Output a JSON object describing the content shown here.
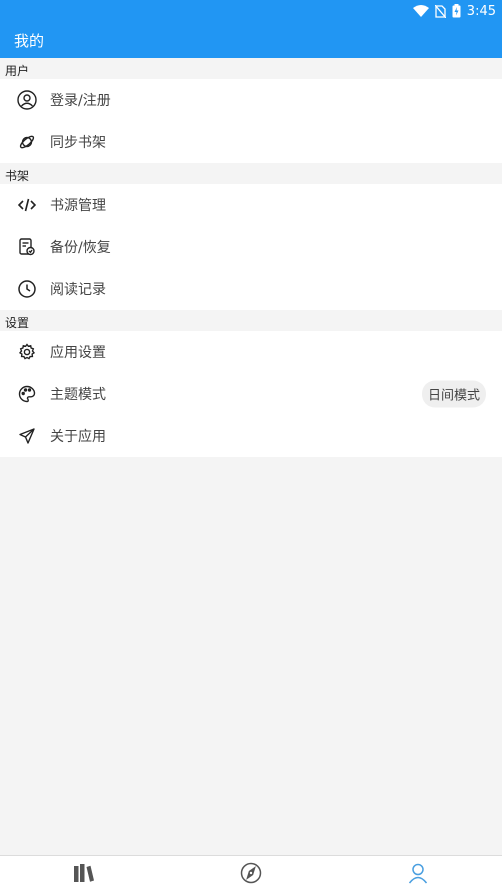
{
  "status": {
    "time": "3:45"
  },
  "app": {
    "title": "我的"
  },
  "sections": [
    {
      "label": "用户",
      "items": [
        {
          "label": "登录/注册",
          "icon": "user-icon"
        },
        {
          "label": "同步书架",
          "icon": "planet-icon"
        }
      ]
    },
    {
      "label": "书架",
      "items": [
        {
          "label": "书源管理",
          "icon": "code-icon"
        },
        {
          "label": "备份/恢复",
          "icon": "backup-icon"
        },
        {
          "label": "阅读记录",
          "icon": "clock-icon"
        }
      ]
    },
    {
      "label": "设置",
      "items": [
        {
          "label": "应用设置",
          "icon": "gear-icon"
        },
        {
          "label": "主题模式",
          "icon": "palette-icon",
          "value": "日间模式"
        },
        {
          "label": "关于应用",
          "icon": "send-icon"
        }
      ]
    }
  ],
  "colors": {
    "primary": "#2196f3",
    "active_nav": "#4a9fe0"
  },
  "bottom_nav": [
    {
      "icon": "bookshelf-icon",
      "active": false
    },
    {
      "icon": "compass-icon",
      "active": false
    },
    {
      "icon": "person-icon",
      "active": true
    }
  ]
}
